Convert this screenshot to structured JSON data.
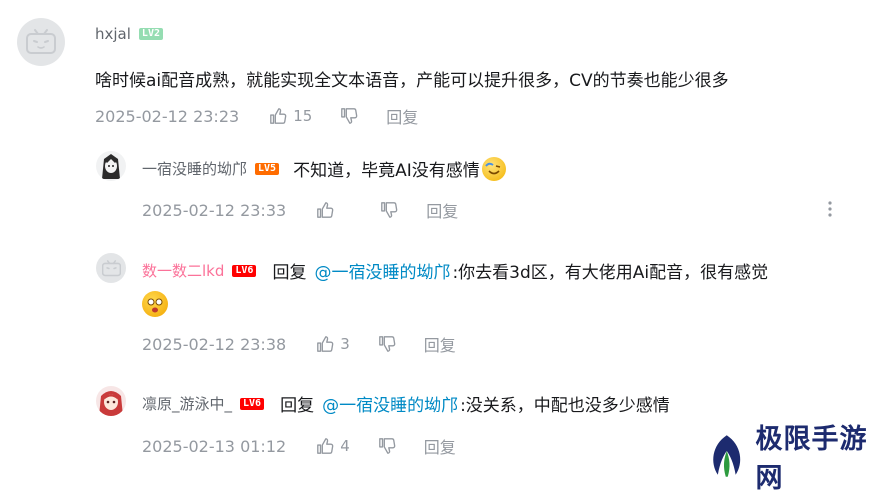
{
  "comment": {
    "username": "hxjal",
    "level": "LV2",
    "text": "啥时候ai配音成熟，就能实现全文本语音，产能可以提升很多，CV的节奏也能少很多",
    "time": "2025-02-12 23:23",
    "likes": "15",
    "reply_label": "回复"
  },
  "replies": [
    {
      "username": "一宿没睡的坳邝",
      "level": "LV5",
      "text": "不知道，毕竟AI没有感情",
      "time": "2025-02-12 23:33",
      "likes": "",
      "reply_label": "回复"
    },
    {
      "username": "数一数二lkd",
      "level": "LV6",
      "reply_prefix": "回复",
      "mention": "@一宿没睡的坳邝",
      "text": ":你去看3d区，有大佬用Ai配音，很有感觉",
      "time": "2025-02-12 23:38",
      "likes": "3",
      "reply_label": "回复"
    },
    {
      "username": "凛原_游泳中_",
      "level": "LV6",
      "reply_prefix": "回复",
      "mention": "@一宿没睡的坳邝",
      "text": ":没关系，中配也没多少感情",
      "time": "2025-02-13 01:12",
      "likes": "4",
      "reply_label": "回复"
    }
  ],
  "watermark": {
    "text": "极限手游网"
  },
  "colors": {
    "mention": "#008ac5",
    "username_vip": "#fb7299",
    "meta": "#9499a0"
  },
  "icons": [
    "thumb-up-icon",
    "thumb-down-icon",
    "more-icon",
    "face-emoji-icon"
  ]
}
